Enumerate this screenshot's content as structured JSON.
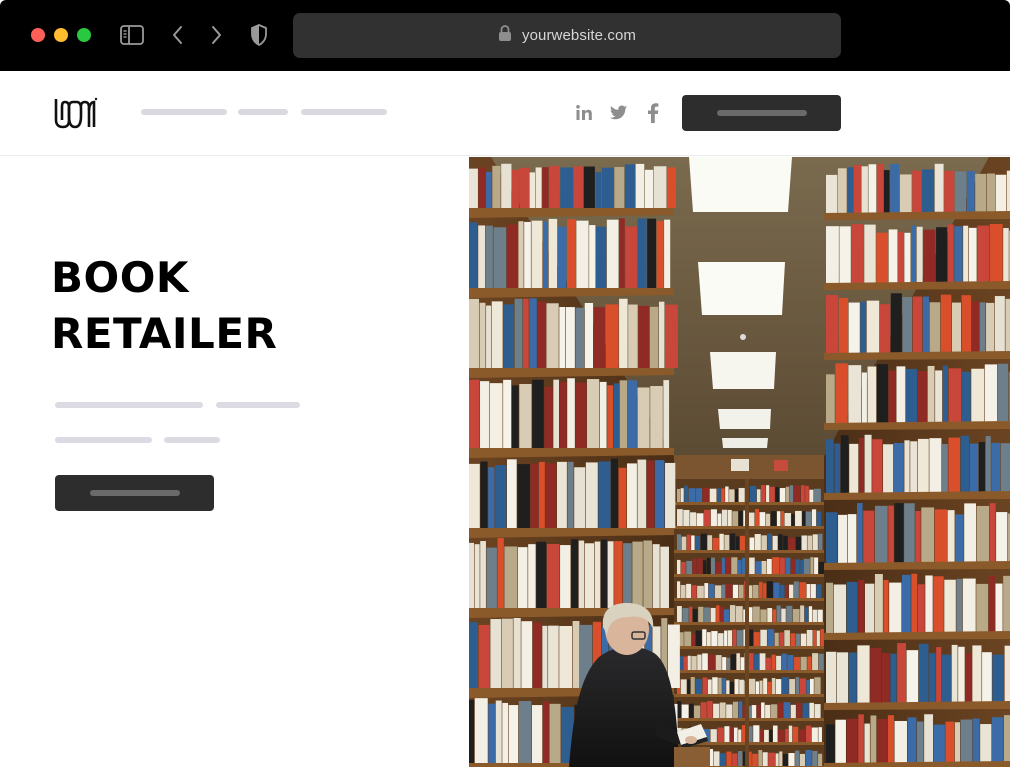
{
  "browser": {
    "url": "yourwebsite.com",
    "icons": {
      "sidebar": "sidebar-icon",
      "back": "chevron-left-icon",
      "forward": "chevron-right-icon",
      "shield": "shield-icon",
      "lock": "lock-icon"
    }
  },
  "header": {
    "logo_text": "LOGO",
    "social": [
      "linkedin-icon",
      "twitter-icon",
      "facebook-icon"
    ]
  },
  "hero": {
    "title_line1": "BOOK",
    "title_line2": "RETAILER"
  },
  "photo": {
    "subject": "bookstore-aisle-photo"
  },
  "colors": {
    "chrome": "#000000",
    "addressbar": "#313131",
    "button": "#2d2d2d",
    "placeholder": "#dcdbe4",
    "text": "#000000"
  }
}
